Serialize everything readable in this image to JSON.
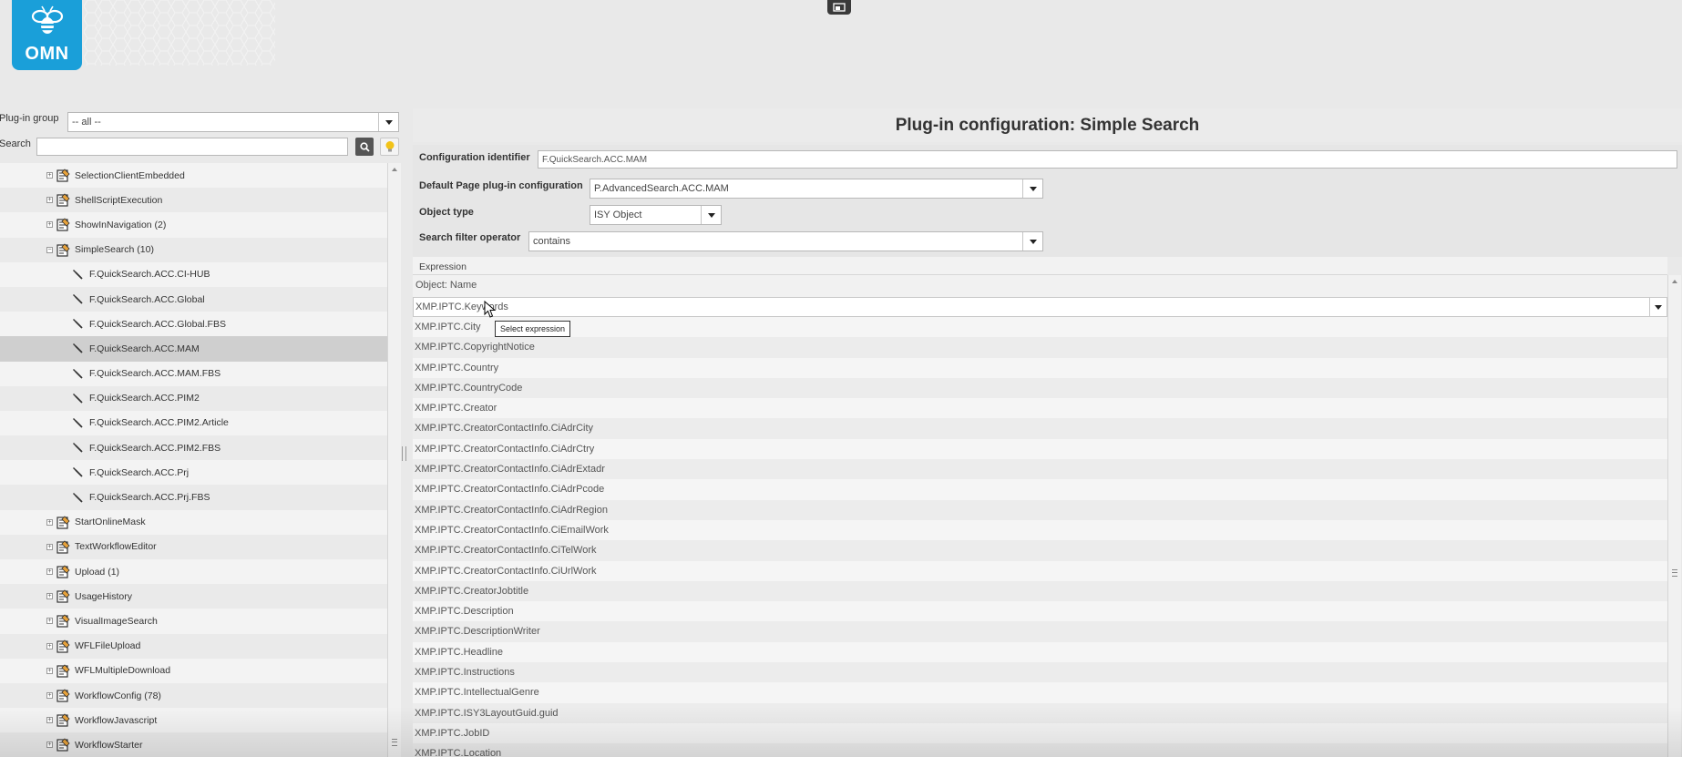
{
  "header": {
    "logo_text": "OMN",
    "icons": [
      "bee-icon",
      "window-icon"
    ]
  },
  "left": {
    "plugin_group_label": "Plug-in group",
    "plugin_group_value": "-- all --",
    "search_label": "Search",
    "search_value": "",
    "tree": [
      {
        "label": "SelectionClientEmbedded",
        "type": "group"
      },
      {
        "label": "ShellScriptExecution",
        "type": "group"
      },
      {
        "label": "ShowInNavigation (2)",
        "type": "group"
      },
      {
        "label": "SimpleSearch (10)",
        "type": "group",
        "expanded": true
      },
      {
        "label": "F.QuickSearch.ACC.CI-HUB",
        "type": "leaf"
      },
      {
        "label": "F.QuickSearch.ACC.Global",
        "type": "leaf"
      },
      {
        "label": "F.QuickSearch.ACC.Global.FBS",
        "type": "leaf"
      },
      {
        "label": "F.QuickSearch.ACC.MAM",
        "type": "leaf",
        "selected": true
      },
      {
        "label": "F.QuickSearch.ACC.MAM.FBS",
        "type": "leaf"
      },
      {
        "label": "F.QuickSearch.ACC.PIM2",
        "type": "leaf"
      },
      {
        "label": "F.QuickSearch.ACC.PIM2.Article",
        "type": "leaf"
      },
      {
        "label": "F.QuickSearch.ACC.PIM2.FBS",
        "type": "leaf"
      },
      {
        "label": "F.QuickSearch.ACC.Prj",
        "type": "leaf"
      },
      {
        "label": "F.QuickSearch.ACC.Prj.FBS",
        "type": "leaf"
      },
      {
        "label": "StartOnlineMask",
        "type": "group"
      },
      {
        "label": "TextWorkflowEditor",
        "type": "group"
      },
      {
        "label": "Upload (1)",
        "type": "group"
      },
      {
        "label": "UsageHistory",
        "type": "group"
      },
      {
        "label": "VisualImageSearch",
        "type": "group"
      },
      {
        "label": "WFLFileUpload",
        "type": "group"
      },
      {
        "label": "WFLMultipleDownload",
        "type": "group"
      },
      {
        "label": "WorkflowConfig (78)",
        "type": "group"
      },
      {
        "label": "WorkflowJavascript",
        "type": "group"
      },
      {
        "label": "WorkflowStarter",
        "type": "group"
      }
    ]
  },
  "right": {
    "title": "Plug-in configuration: Simple Search",
    "config_id_label": "Configuration identifier",
    "config_id_value": "F.QuickSearch.ACC.MAM",
    "default_page_label": "Default Page plug-in configuration",
    "default_page_value": "P.AdvancedSearch.ACC.MAM",
    "object_type_label": "Object type",
    "object_type_value": "ISY Object",
    "filter_op_label": "Search filter operator",
    "filter_op_value": "contains",
    "grid_header": "Expression",
    "grid_first_row": "Object: Name",
    "editor_value": "XMP.IPTC.Keywords",
    "tooltip": "Select expression",
    "options": [
      "XMP.IPTC.City",
      "XMP.IPTC.CopyrightNotice",
      "XMP.IPTC.Country",
      "XMP.IPTC.CountryCode",
      "XMP.IPTC.Creator",
      "XMP.IPTC.CreatorContactInfo.CiAdrCity",
      "XMP.IPTC.CreatorContactInfo.CiAdrCtry",
      "XMP.IPTC.CreatorContactInfo.CiAdrExtadr",
      "XMP.IPTC.CreatorContactInfo.CiAdrPcode",
      "XMP.IPTC.CreatorContactInfo.CiAdrRegion",
      "XMP.IPTC.CreatorContactInfo.CiEmailWork",
      "XMP.IPTC.CreatorContactInfo.CiTelWork",
      "XMP.IPTC.CreatorContactInfo.CiUrlWork",
      "XMP.IPTC.CreatorJobtitle",
      "XMP.IPTC.Description",
      "XMP.IPTC.DescriptionWriter",
      "XMP.IPTC.Headline",
      "XMP.IPTC.Instructions",
      "XMP.IPTC.IntellectualGenre",
      "XMP.IPTC.ISY3LayoutGuid.guid",
      "XMP.IPTC.JobID",
      "XMP.IPTC.Location"
    ]
  },
  "colors": {
    "brand": "#1a9fd9",
    "background": "#e9e9e9",
    "selected_row": "#cfcfcf"
  }
}
